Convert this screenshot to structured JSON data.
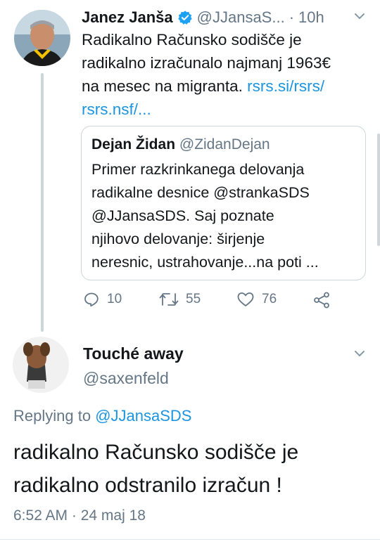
{
  "tweet": {
    "author_name": "Janez Janša",
    "author_handle": "@JJansaS...",
    "separator": "·",
    "time": "10h",
    "text_line1": "Radikalno Računsko sodišče je",
    "text_line2": "radikalno izračunalo najmanj 1963€",
    "text_line3": "na mesec na migranta.",
    "link1": "rsrs.si/rsrs/",
    "link2": "rsrs.nsf/...",
    "quoted": {
      "author_name": "Dejan Židan",
      "author_handle": "@ZidanDejan",
      "lines": [
        "Primer razkrinkanega delovanja",
        "radikalne desnice @strankaSDS",
        "@JJansaSDS. Saj poznate",
        "njihovo delovanje: širjenje",
        "neresnic, ustrahovanje...na poti ..."
      ]
    },
    "replies": "10",
    "retweets": "55",
    "likes": "76"
  },
  "reply": {
    "author_name": "Touché away",
    "author_handle": "@saxenfeld",
    "replying_prefix": "Replying to",
    "replying_handle": "@JJansaSDS",
    "text_line1": "radikalno Računsko sodišče je",
    "text_line2": "radikalno odstranilo izračun !",
    "timestamp": "6:52 AM · 24 maj 18"
  },
  "colors": {
    "link": "#1b95e0",
    "secondary_text": "#657786",
    "verified": "#1da1f2",
    "border": "#ccd6dd"
  },
  "icons": [
    "verified-badge-icon",
    "chevron-down-icon",
    "reply-icon",
    "retweet-icon",
    "like-icon",
    "share-icon"
  ]
}
